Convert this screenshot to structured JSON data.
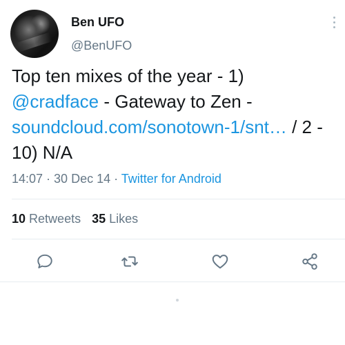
{
  "user": {
    "display_name": "Ben UFO",
    "handle": "@BenUFO"
  },
  "tweet": {
    "text_1": "Top ten mixes of the year - 1) ",
    "mention": "@cradface",
    "text_2": " - Gateway to Zen - ",
    "link": "soundcloud.com/sonotown-1/snt…",
    "text_3": " / 2 - 10) N/A"
  },
  "meta": {
    "time": "14:07",
    "sep1": " · ",
    "date": "30 Dec 14",
    "sep2": " · ",
    "source": "Twitter for Android"
  },
  "stats": {
    "retweets_count": "10",
    "retweets_label": "Retweets",
    "likes_count": "35",
    "likes_label": "Likes"
  },
  "icons": {
    "reply": "reply-icon",
    "retweet": "retweet-icon",
    "like": "heart-icon",
    "share": "share-icon",
    "more": "more-vertical-icon"
  },
  "colors": {
    "accent": "#1b95e0",
    "secondary_text": "#657786",
    "icon": "#657786",
    "divider": "#e6ecf0"
  }
}
